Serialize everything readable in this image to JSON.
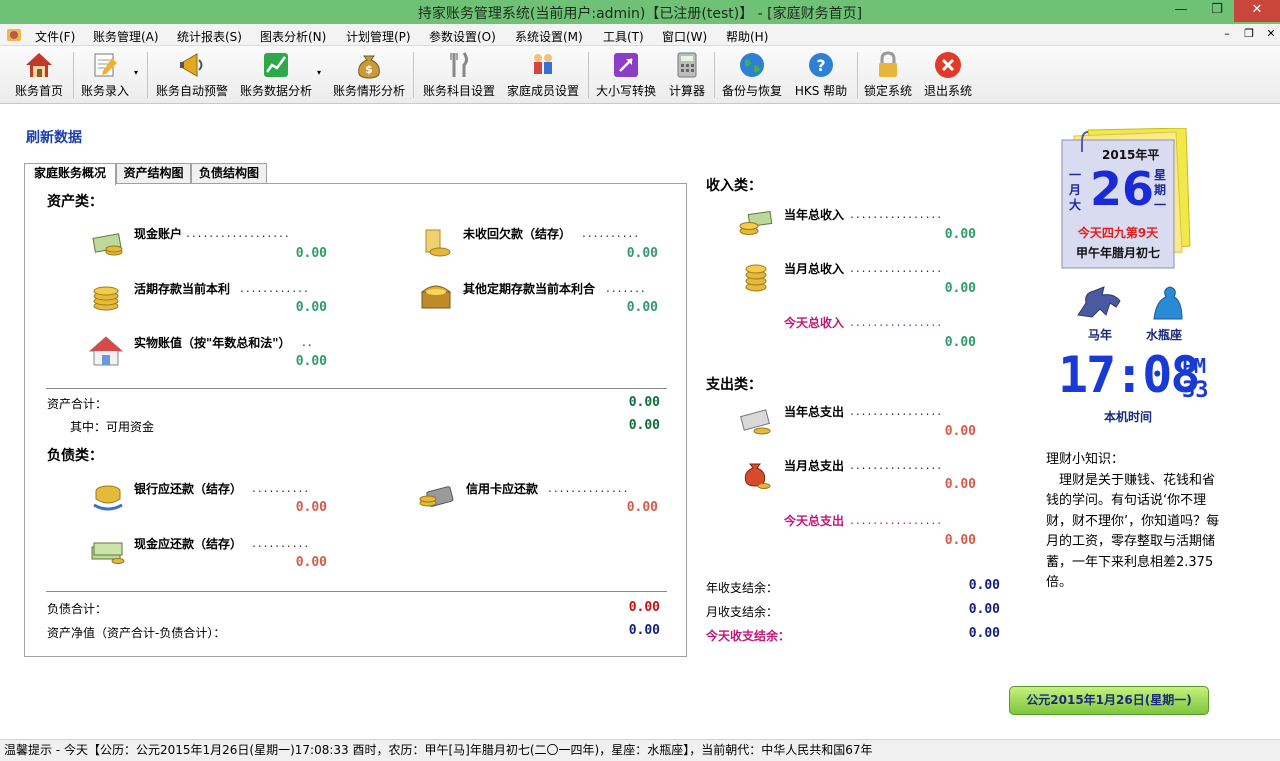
{
  "window": {
    "title": "持家账务管理系统(当前用户:admin)【已注册(test)】 - [家庭财务首页]",
    "min": "—",
    "restore": "❐",
    "close": "✕"
  },
  "menu": [
    "文件(F)",
    "账务管理(A)",
    "统计报表(S)",
    "图表分析(N)",
    "计划管理(P)",
    "参数设置(O)",
    "系统设置(M)",
    "工具(T)",
    "窗口(W)",
    "帮助(H)"
  ],
  "mdi": {
    "min": "–",
    "restore": "❐",
    "close": "✕"
  },
  "toolbar": [
    {
      "label": "账务首页",
      "icon": "house-icon"
    },
    {
      "label": "账务录入",
      "icon": "notepad-pencil-icon",
      "dropdown": "▾"
    },
    {
      "label": "账务自动预警",
      "icon": "megaphone-icon"
    },
    {
      "label": "账务数据分析",
      "icon": "chart-icon",
      "dropdown": "▾"
    },
    {
      "label": "账务情形分析",
      "icon": "money-bag-icon"
    },
    {
      "label": "账务科目设置",
      "icon": "fork-knife-icon"
    },
    {
      "label": "家庭成员设置",
      "icon": "family-icon"
    },
    {
      "label": "大小写转换",
      "icon": "convert-icon"
    },
    {
      "label": "计算器",
      "icon": "calculator-icon"
    },
    {
      "label": "备份与恢复",
      "icon": "globe-icon"
    },
    {
      "label": "HKS 帮助",
      "icon": "help-icon"
    },
    {
      "label": "锁定系统",
      "icon": "lock-icon"
    },
    {
      "label": "退出系统",
      "icon": "exit-icon"
    }
  ],
  "refresh": "刷新数据",
  "tabs": [
    "家庭账务概况",
    "资产结构图",
    "负债结构图"
  ],
  "assets": {
    "title": "资产类：",
    "items": [
      {
        "label": "现金账户",
        "value": "0.00"
      },
      {
        "label": "未收回欠款（结存）",
        "value": "0.00"
      },
      {
        "label": "活期存款当前本利",
        "value": "0.00"
      },
      {
        "label": "其他定期存款当前本利合",
        "value": "0.00"
      },
      {
        "label": "实物账值（按\"年数总和法\"）",
        "value": "0.00"
      }
    ],
    "total_label": "资产合计：",
    "total_value": "0.00",
    "available_label": "其中：可用资金",
    "available_value": "0.00"
  },
  "liabilities": {
    "title": "负债类：",
    "items": [
      {
        "label": "银行应还款（结存）",
        "value": "0.00"
      },
      {
        "label": "信用卡应还款",
        "value": "0.00"
      },
      {
        "label": "现金应还款（结存）",
        "value": "0.00"
      }
    ],
    "total_label": "负债合计：",
    "total_value": "0.00",
    "net_label": "资产净值（资产合计-负债合计）：",
    "net_value": "0.00"
  },
  "income": {
    "title": "收入类：",
    "items": [
      {
        "label": "当年总收入",
        "value": "0.00"
      },
      {
        "label": "当月总收入",
        "value": "0.00"
      },
      {
        "label": "今天总收入",
        "value": "0.00"
      }
    ]
  },
  "expense": {
    "title": "支出类：",
    "items": [
      {
        "label": "当年总支出",
        "value": "0.00"
      },
      {
        "label": "当月总支出",
        "value": "0.00"
      },
      {
        "label": "今天总支出",
        "value": "0.00"
      }
    ]
  },
  "balance": [
    {
      "label": "年收支结余：",
      "value": "0.00"
    },
    {
      "label": "月收支结余：",
      "value": "0.00"
    },
    {
      "label": "今天收支结余：",
      "value": "0.00"
    }
  ],
  "calendar": {
    "year": "2015年平",
    "month": "一月大",
    "day": "26",
    "weekday": "星期一",
    "shujiu": "今天四九第9天",
    "lunar": "甲午年腊月初七"
  },
  "zodiac": {
    "animal": "马年",
    "constellation": "水瓶座"
  },
  "clock": {
    "time": "17:08",
    "ampm": "PM",
    "seconds": "33",
    "label": "本机时间"
  },
  "tips": {
    "title": "理财小知识：",
    "text": "理财是关于赚钱、花钱和省钱的学问。有句话说‘你不理财，财不理你’，你知道吗？每月的工资，零存整取与活期储蓄，一年下来利息相差2.375倍。"
  },
  "date_button": "公元2015年1月26日(星期一)",
  "status": "温馨提示 - 今天【公历：公元2015年1月26日(星期一)17:08:33 酉时，农历：甲午[马]年腊月初七(二〇一四年)，星座：水瓶座】，当前朝代：中华人民共和国67年",
  "colors": {
    "titlebar": "#6fc275",
    "accent": "#1c3faa",
    "income": "#2f9a6b",
    "expense": "#d65a4a",
    "highlight": "#c3157a"
  }
}
